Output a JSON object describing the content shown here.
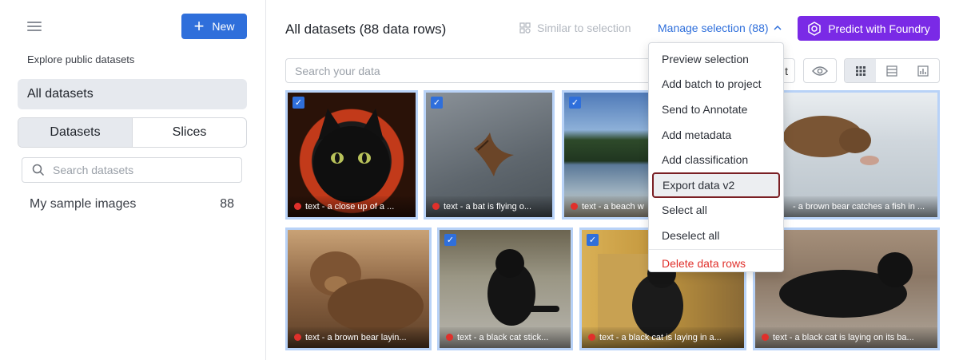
{
  "sidebar": {
    "new_label": "New",
    "explore_label": "Explore public datasets",
    "all_datasets_label": "All datasets",
    "tabs": [
      "Datasets",
      "Slices"
    ],
    "search_placeholder": "Search datasets",
    "dataset": {
      "name": "My sample images",
      "count": "88"
    }
  },
  "header": {
    "title": "All datasets (88 data rows)",
    "similar_label": "Similar to selection",
    "manage_label": "Manage selection (88)",
    "predict_label": "Predict with Foundry"
  },
  "toolbar": {
    "search_placeholder": "Search your data",
    "partial_button_text": "t"
  },
  "menu": {
    "items": [
      "Preview selection",
      "Add batch to project",
      "Send to Annotate",
      "Add metadata",
      "Add classification",
      "Export data v2",
      "Select all",
      "Deselect all"
    ],
    "delete_label": "Delete data rows",
    "highlighted": "Export data v2"
  },
  "grid": {
    "tiles": [
      {
        "caption": "text - a close up of a ...",
        "checked": true
      },
      {
        "caption": "text - a bat is flying o...",
        "checked": true
      },
      {
        "caption": "text - a beach w",
        "checked": true
      },
      {
        "caption": "- a brown bear catches a fish in ...",
        "checked": false
      },
      {
        "caption": "text - a brown bear layin...",
        "checked": false
      },
      {
        "caption": "text - a black cat stick...",
        "checked": true
      },
      {
        "caption": "text - a black cat is laying in a...",
        "checked": true
      },
      {
        "caption": "text - a black cat is laying on its ba...",
        "checked": false
      }
    ]
  },
  "colors": {
    "accent": "#2f6fdb",
    "predict": "#7a2ae6",
    "danger": "#e0302b",
    "selection": "#b8d2f7"
  }
}
